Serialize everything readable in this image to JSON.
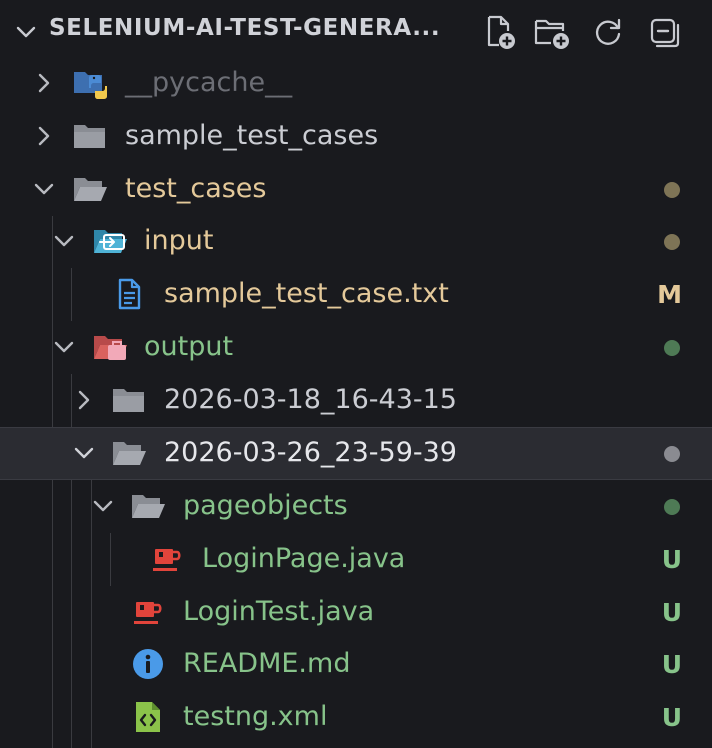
{
  "header": {
    "title": "SELENIUM-AI-TEST-GENERA..."
  },
  "tree": [
    {
      "label": "__pycache__",
      "color": "#6c6e75",
      "icon": "python-folder-icon",
      "badge": "",
      "dot": ""
    },
    {
      "label": "sample_test_cases",
      "color": "#cbcdd3",
      "icon": "folder-icon",
      "badge": "",
      "dot": ""
    },
    {
      "label": "test_cases",
      "color": "#e4c99a",
      "icon": "folder-open-icon",
      "badge": "",
      "dot": "#7e7456"
    },
    {
      "label": "input",
      "color": "#e4c99a",
      "icon": "input-folder-icon",
      "badge": "",
      "dot": "#7e7456"
    },
    {
      "label": "sample_test_case.txt",
      "color": "#e4c99a",
      "icon": "text-file-icon",
      "badge": "M",
      "dot": ""
    },
    {
      "label": "output",
      "color": "#87c38a",
      "icon": "output-folder-icon",
      "badge": "",
      "dot": "#4e7a55"
    },
    {
      "label": "2026-03-18_16-43-15",
      "color": "#cbcdd3",
      "icon": "folder-icon",
      "badge": "",
      "dot": ""
    },
    {
      "label": "2026-03-26_23-59-39",
      "color": "#e6e7eb",
      "icon": "folder-open-icon",
      "badge": "",
      "dot": "#8a8b91"
    },
    {
      "label": "pageobjects",
      "color": "#87c38a",
      "icon": "folder-open-icon",
      "badge": "",
      "dot": "#4e7a55"
    },
    {
      "label": "LoginPage.java",
      "color": "#87c38a",
      "icon": "java-file-icon",
      "badge": "U",
      "dot": ""
    },
    {
      "label": "LoginTest.java",
      "color": "#87c38a",
      "icon": "java-file-icon",
      "badge": "U",
      "dot": ""
    },
    {
      "label": "README.md",
      "color": "#87c38a",
      "icon": "info-file-icon",
      "badge": "U",
      "dot": ""
    },
    {
      "label": "testng.xml",
      "color": "#87c38a",
      "icon": "xml-file-icon",
      "badge": "U",
      "dot": ""
    }
  ],
  "colors": {
    "background": "#191a1e",
    "selected_row": "#2b2c32",
    "modified": "#e4c99a",
    "untracked": "#87c38a"
  }
}
